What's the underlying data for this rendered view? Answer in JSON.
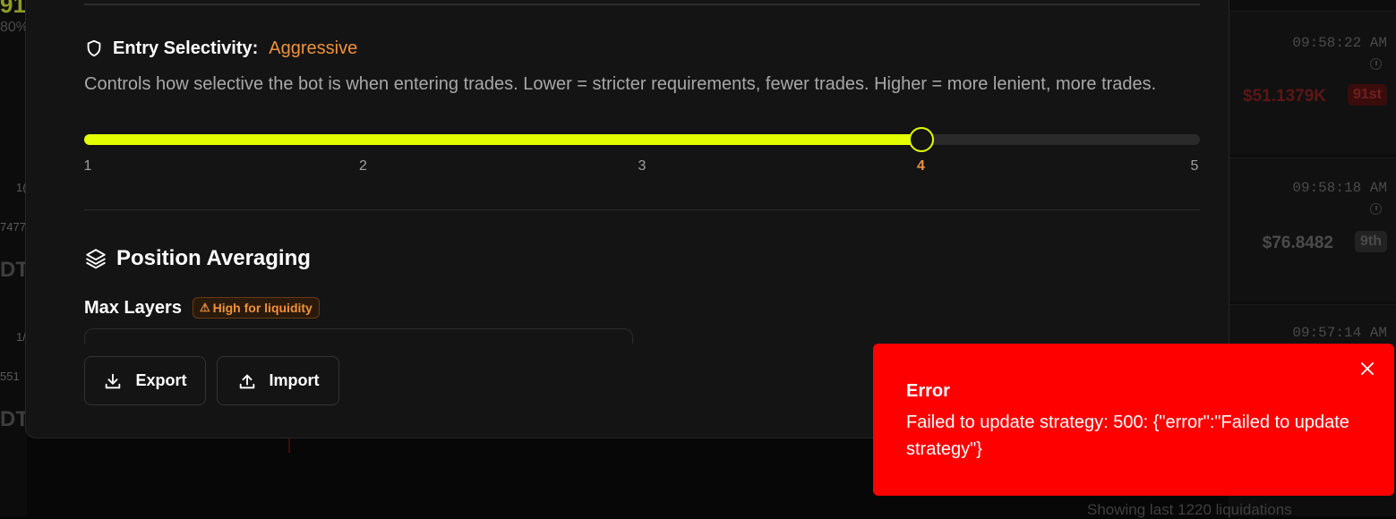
{
  "background": {
    "left_fragments": [
      "91",
      "80%",
      "1(",
      "7477",
      "DT",
      "1/",
      "551",
      "DT"
    ],
    "feed": [
      {
        "time": "09:58:22 AM",
        "amount": "$51.1379K",
        "rank": "91st",
        "amount_color": "#5c1616",
        "badge_bg": "#3b0c0c",
        "badge_color": "#6e2020"
      },
      {
        "time": "09:58:18 AM",
        "amount": "$76.8482",
        "rank": "9th",
        "amount_color": "#4b4b4b",
        "badge_bg": "#222222",
        "badge_color": "#4a4a4a"
      },
      {
        "time": "09:57:14 AM"
      }
    ],
    "footer_note": "Showing last 1220 liquidations"
  },
  "entry_selectivity": {
    "icon": "shield-icon",
    "label": "Entry Selectivity:",
    "value_label": "Aggressive",
    "description": "Controls how selective the bot is when entering trades. Lower = stricter requirements, fewer trades. Higher = more lenient, more trades.",
    "slider": {
      "min": 1,
      "max": 5,
      "value": 4,
      "ticks": [
        "1",
        "2",
        "3",
        "4",
        "5"
      ],
      "fill_color": "#e4ff00"
    }
  },
  "position_averaging": {
    "icon": "layers-icon",
    "title": "Position Averaging",
    "max_layers_label": "Max Layers",
    "badge_icon": "⚠",
    "badge_text": "High for liquidity"
  },
  "actions": {
    "export_label": "Export",
    "import_label": "Import"
  },
  "toast": {
    "title": "Error",
    "message": "Failed to update strategy: 500: {\"error\":\"Failed to update strategy\"}",
    "bg_color": "#ff0000"
  }
}
